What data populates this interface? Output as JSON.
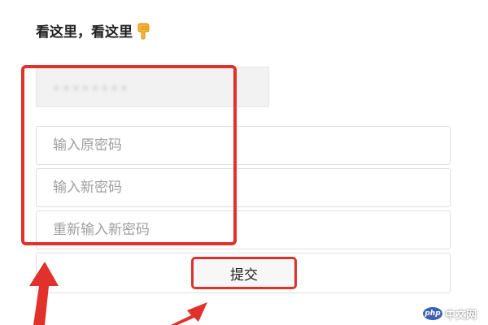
{
  "header": {
    "title": "看这里，看这里",
    "icon": "pointing-down-hand-icon"
  },
  "account": {
    "masked_value": "••••••••"
  },
  "form": {
    "old_password_placeholder": "输入原密码",
    "new_password_placeholder": "输入新密码",
    "confirm_password_placeholder": "重新输入新密码",
    "submit_label": "提交"
  },
  "annotations": {
    "highlight_color": "#e0312b"
  },
  "watermark": {
    "logo_text": "php",
    "text": "中文网"
  }
}
